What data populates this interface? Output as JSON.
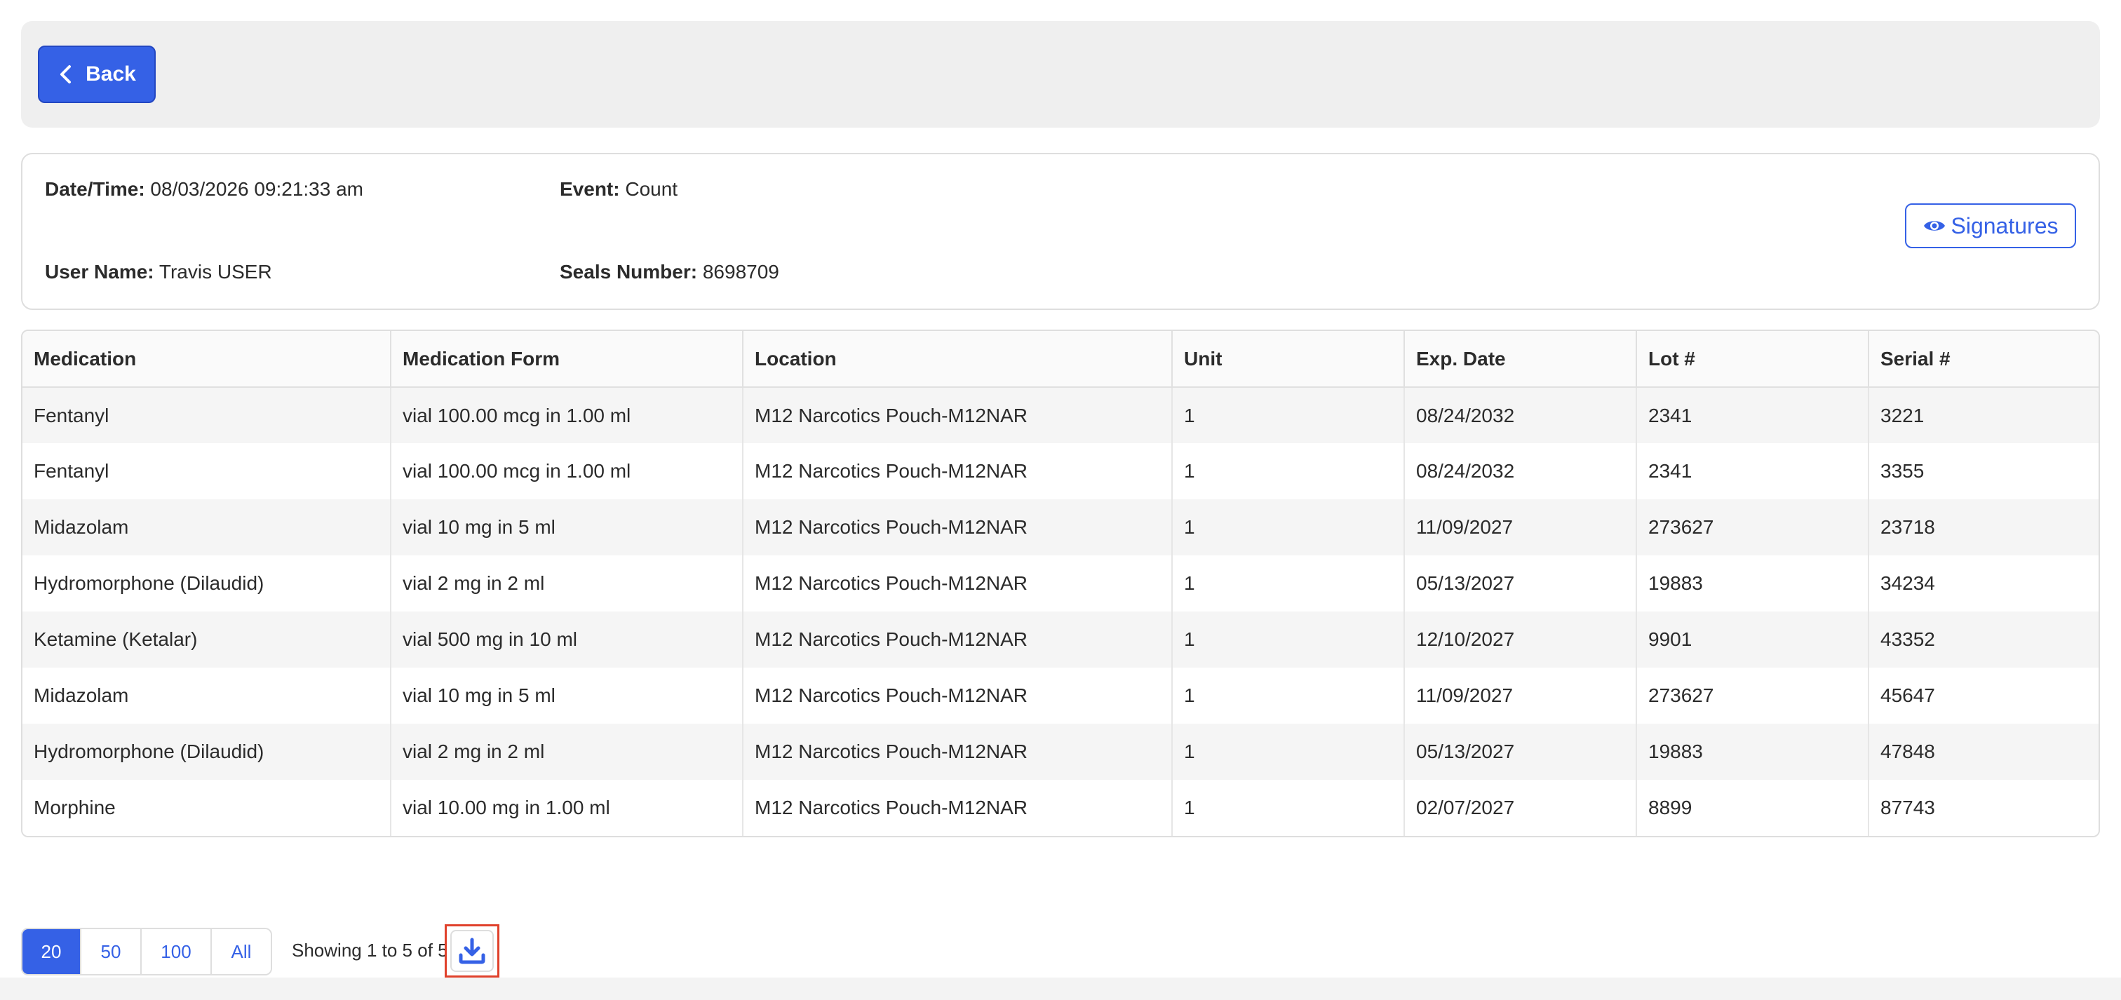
{
  "header": {
    "back_label": "Back"
  },
  "info": {
    "datetime_label": "Date/Time:",
    "datetime_value": "08/03/2026 09:21:33 am",
    "event_label": "Event:",
    "event_value": "Count",
    "username_label": "User Name:",
    "username_value": "Travis USER",
    "seals_label": "Seals Number:",
    "seals_value": "8698709",
    "signatures_label": "Signatures"
  },
  "table": {
    "columns": [
      "Medication",
      "Medication Form",
      "Location",
      "Unit",
      "Exp. Date",
      "Lot #",
      "Serial #"
    ],
    "rows": [
      [
        "Fentanyl",
        "vial 100.00 mcg in 1.00 ml",
        "M12 Narcotics Pouch-M12NAR",
        "1",
        "08/24/2032",
        "2341",
        "3221"
      ],
      [
        "Fentanyl",
        "vial 100.00 mcg in 1.00 ml",
        "M12 Narcotics Pouch-M12NAR",
        "1",
        "08/24/2032",
        "2341",
        "3355"
      ],
      [
        "Midazolam",
        "vial 10 mg in 5 ml",
        "M12 Narcotics Pouch-M12NAR",
        "1",
        "11/09/2027",
        "273627",
        "23718"
      ],
      [
        "Hydromorphone (Dilaudid)",
        "vial 2 mg in 2 ml",
        "M12 Narcotics Pouch-M12NAR",
        "1",
        "05/13/2027",
        "19883",
        "34234"
      ],
      [
        "Ketamine (Ketalar)",
        "vial 500 mg in 10 ml",
        "M12 Narcotics Pouch-M12NAR",
        "1",
        "12/10/2027",
        "9901",
        "43352"
      ],
      [
        "Midazolam",
        "vial 10 mg in 5 ml",
        "M12 Narcotics Pouch-M12NAR",
        "1",
        "11/09/2027",
        "273627",
        "45647"
      ],
      [
        "Hydromorphone (Dilaudid)",
        "vial 2 mg in 2 ml",
        "M12 Narcotics Pouch-M12NAR",
        "1",
        "05/13/2027",
        "19883",
        "47848"
      ],
      [
        "Morphine",
        "vial 10.00 mg in 1.00 ml",
        "M12 Narcotics Pouch-M12NAR",
        "1",
        "02/07/2027",
        "8899",
        "87743"
      ]
    ]
  },
  "pagination": {
    "sizes": [
      "20",
      "50",
      "100",
      "All"
    ],
    "active": "20",
    "showing_text": "Showing 1 to 5 of 5"
  },
  "icons": {
    "back": "chevron-left-icon",
    "signatures": "eye-icon",
    "download": "download-icon"
  },
  "colors": {
    "primary": "#3561e6",
    "highlight_border": "#e0412b"
  }
}
